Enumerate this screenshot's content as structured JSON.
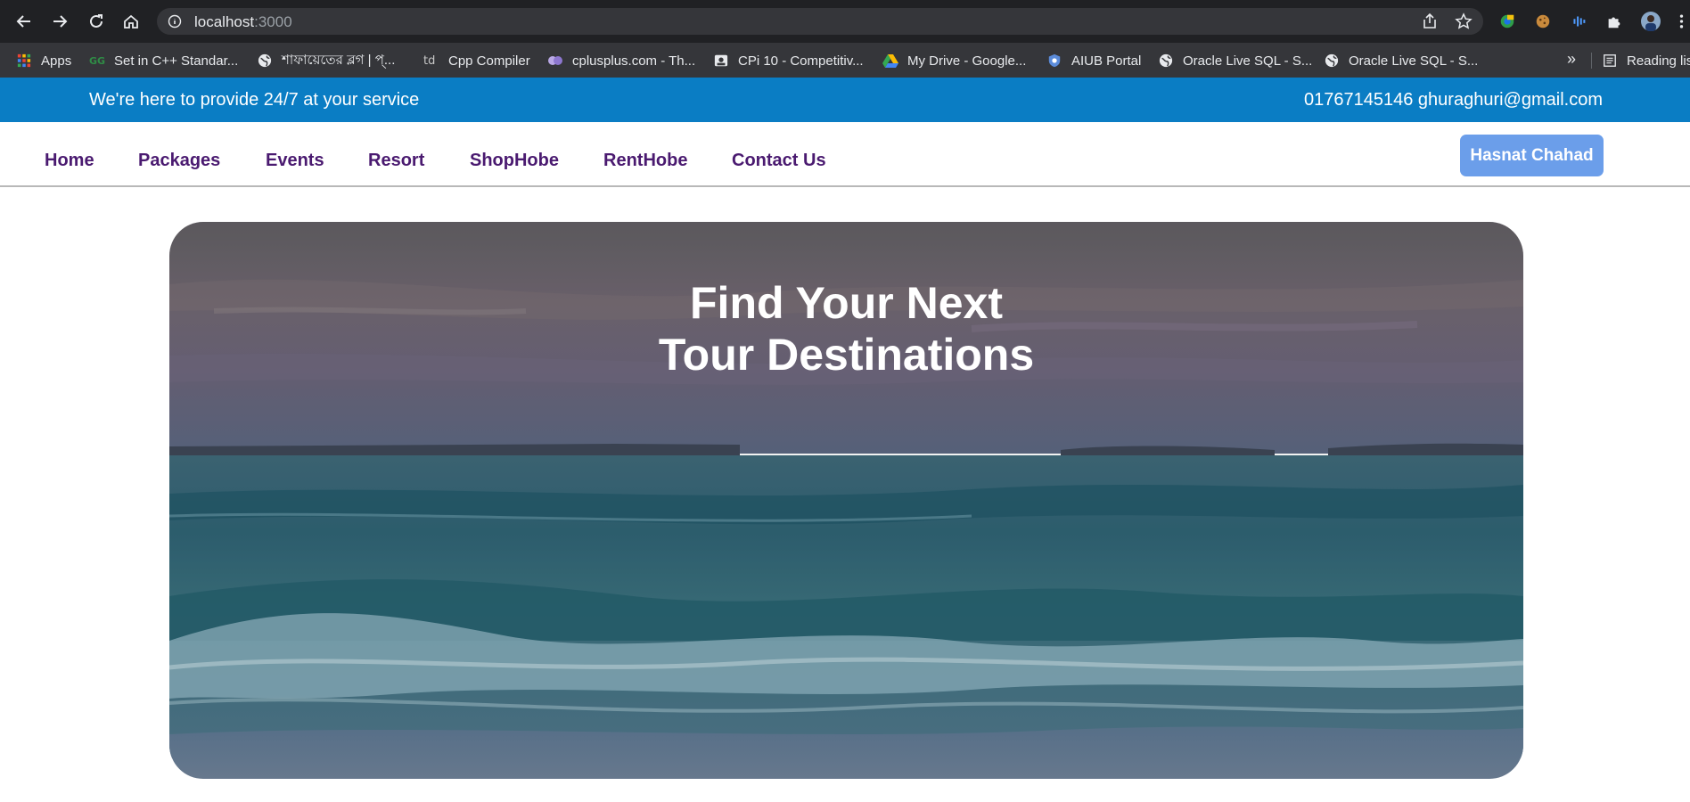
{
  "browser": {
    "url_host": "localhost",
    "url_port": ":3000",
    "bookmarks": [
      {
        "label": "Apps",
        "icon": "apps-grid-icon"
      },
      {
        "label": "Set in C++ Standar...",
        "icon": "gfg-icon"
      },
      {
        "label": "শাফায়েতের ব্লগ | প্...",
        "icon": "globe-icon"
      },
      {
        "label": "Cpp Compiler",
        "icon": "td-icon"
      },
      {
        "label": "cplusplus.com - Th...",
        "icon": "cplusplus-icon"
      },
      {
        "label": "CPi 10 - Competitiv...",
        "icon": "contact-card-icon"
      },
      {
        "label": "My Drive - Google...",
        "icon": "google-drive-icon"
      },
      {
        "label": "AIUB Portal",
        "icon": "aiub-shield-icon"
      },
      {
        "label": "Oracle Live SQL - S...",
        "icon": "globe-icon"
      },
      {
        "label": "Oracle Live SQL - S...",
        "icon": "globe-icon"
      }
    ],
    "more_label": "»",
    "reading_list_label": "Reading lis"
  },
  "topbar": {
    "tagline": "We're here to provide 24/7 at your service",
    "contact": "01767145146 ghuraghuri@gmail.com"
  },
  "nav": {
    "items": [
      "Home",
      "Packages",
      "Events",
      "Resort",
      "ShopHobe",
      "RentHobe",
      "Contact Us"
    ],
    "user_button": "Hasnat Chahad"
  },
  "hero": {
    "title_line1": "Find Your Next",
    "title_line2": "Tour Destinations"
  },
  "colors": {
    "topbar_bg": "#0a7dc4",
    "nav_text": "#4a1a70",
    "user_button_bg": "#6b9eea"
  }
}
